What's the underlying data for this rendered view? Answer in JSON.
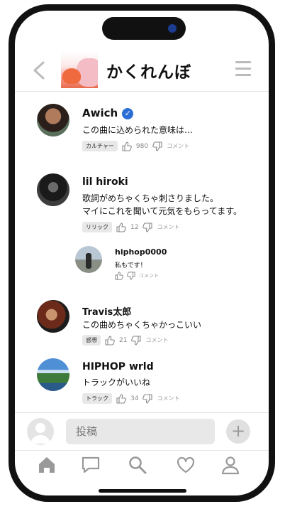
{
  "header": {
    "title": "かくれんぼ"
  },
  "comments": [
    {
      "name": "Awich",
      "verified": true,
      "text": [
        "この曲に込められた意味は…"
      ],
      "tag": "カルチャー",
      "likes": "980",
      "dislike_label": "コメント"
    },
    {
      "name": "lil hiroki",
      "verified": false,
      "text": [
        "歌詞がめちゃくちゃ刺さりました。",
        "マイにこれを聞いて元気をもらってます。"
      ],
      "tag": "リリック",
      "likes": "12",
      "dislike_label": "コメント"
    },
    {
      "name": "Travis太郎",
      "verified": false,
      "text": [
        "この曲めちゃくちゃかっこいい"
      ],
      "tag": "感想",
      "likes": "21",
      "dislike_label": "コメント"
    },
    {
      "name": "HIPHOP wrld",
      "verified": false,
      "text": [
        "トラックがいいね"
      ],
      "tag": "トラック",
      "likes": "34",
      "dislike_label": "コメント"
    }
  ],
  "reply": {
    "name": "hiphop0000",
    "text": "私もです！",
    "comment_label": "コメント"
  },
  "composer": {
    "placeholder": "投稿",
    "add_symbol": "+"
  },
  "colors": {
    "verified": "#2b6fd6",
    "frame": "#111111",
    "notch_camera": "#1b3c8f"
  },
  "icons": [
    "back-chevron-icon",
    "hamburger-menu-icon",
    "thumbs-up-icon",
    "thumbs-down-icon",
    "home-icon",
    "chat-icon",
    "search-icon",
    "heart-icon",
    "profile-icon"
  ]
}
